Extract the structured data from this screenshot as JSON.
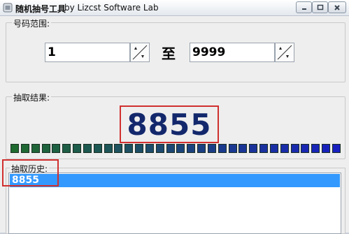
{
  "window": {
    "title": "随机抽号工具",
    "subtitle": "by Lizcst Software Lab",
    "buttons": [
      "minimize",
      "maximize",
      "close"
    ]
  },
  "range_group": {
    "legend": "号码范围:",
    "min_value": "1",
    "separator": "至",
    "max_value": "9999"
  },
  "result_group": {
    "legend": "抽取结果:",
    "value": "8855",
    "progress": {
      "segments": 32,
      "gradient_from": "#1f6a2f",
      "gradient_to": "#1820c0"
    }
  },
  "history_group": {
    "legend": "抽取历史:",
    "items": [
      "8855"
    ],
    "selected_index": 0
  },
  "colors": {
    "result_text": "#13286c",
    "highlight_border": "#d0302f",
    "selection": "#3399ff"
  }
}
